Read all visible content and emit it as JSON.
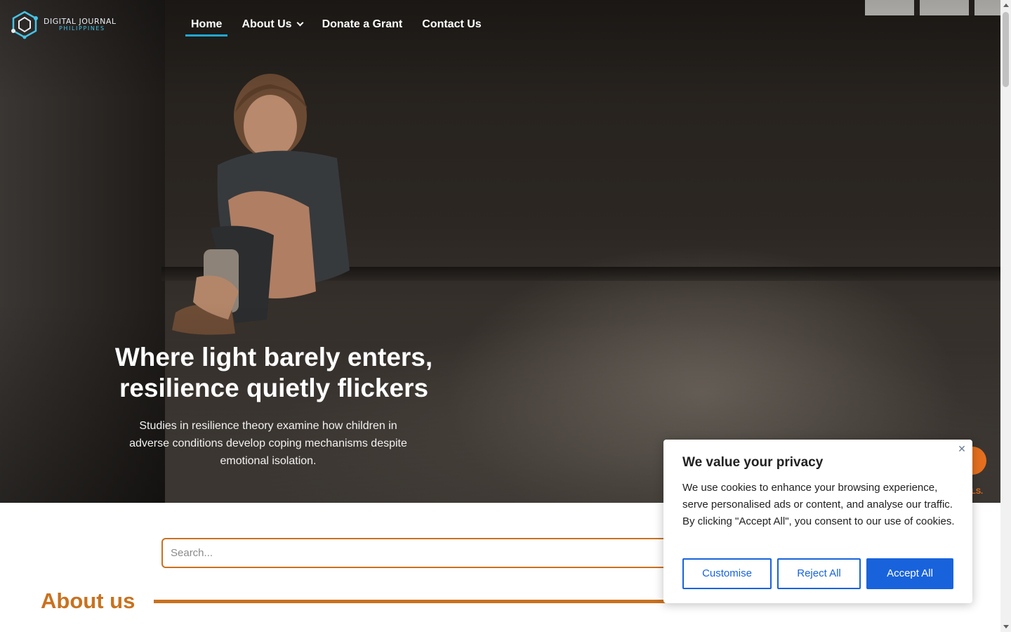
{
  "brand": {
    "name_main": "DIGITAL JOURNAL",
    "name_sub": "PHILIPPINES",
    "logo_icon": "hexagon-network-logo-icon"
  },
  "nav": {
    "items": [
      {
        "label": "Home",
        "active": true
      },
      {
        "label": "About Us",
        "has_dropdown": true
      },
      {
        "label": "Donate a Grant"
      },
      {
        "label": "Contact Us"
      }
    ]
  },
  "hero": {
    "title": "Where light barely enters, resilience quietly flickers",
    "subtitle": "Studies in resilience theory examine how children in adverse conditions develop coping mechanisms despite emotional isolation."
  },
  "search": {
    "placeholder": "Search..."
  },
  "about": {
    "title": "About us"
  },
  "floating": {
    "label_fragment": "LS."
  },
  "cookie_banner": {
    "title": "We value your privacy",
    "body": "We use cookies to enhance your browsing experience, serve personalised ads or content, and analyse our traffic. By clicking \"Accept All\", you consent to our use of cookies.",
    "buttons": {
      "customise": "Customise",
      "reject": "Reject All",
      "accept": "Accept All"
    },
    "close_symbol": "✕"
  },
  "colors": {
    "accent_orange": "#c9711e",
    "nav_active_underline": "#1fa8d1",
    "cookie_blue": "#1863dc",
    "logo_cyan": "#46c3e6"
  }
}
